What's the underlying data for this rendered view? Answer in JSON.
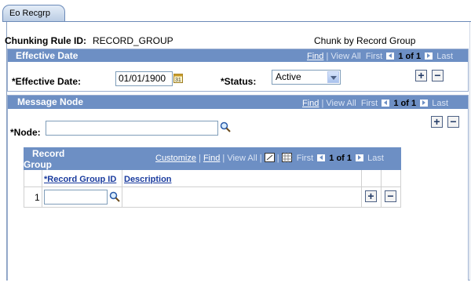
{
  "tab": {
    "label": "Eo Recgrp"
  },
  "header": {
    "chunking_rule_label": "Chunking Rule ID:",
    "chunking_rule_value": "RECORD_GROUP",
    "chunk_by": "Chunk by Record Group"
  },
  "effective_date_box": {
    "title": "Effective Date",
    "nav": {
      "find": "Find",
      "view_all": "View All",
      "first": "First",
      "count": "1 of 1",
      "last": "Last"
    },
    "effective_date_label": "*Effective Date:",
    "effective_date_value": "01/01/1900",
    "status_label": "*Status:",
    "status_value": "Active",
    "add_label": "+",
    "remove_label": "−"
  },
  "message_node_box": {
    "title": "Message Node",
    "nav": {
      "find": "Find",
      "view_all": "View All",
      "first": "First",
      "count": "1 of 1",
      "last": "Last"
    },
    "node_label": "*Node:",
    "node_value": "",
    "add_label": "+",
    "remove_label": "−"
  },
  "record_group_grid": {
    "title_line1": "Record",
    "title_line2": "Group",
    "nav": {
      "customize": "Customize",
      "find": "Find",
      "view_all": "View All",
      "first": "First",
      "count": "1 of 1",
      "last": "Last"
    },
    "columns": [
      "*Record Group ID",
      "Description"
    ],
    "rows": [
      {
        "num": "1",
        "record_group_id": "",
        "description": ""
      }
    ],
    "add_label": "+",
    "remove_label": "−"
  },
  "colors": {
    "header_blue": "#6d8fc4",
    "link_blue": "#1a3b9e"
  },
  "icons": [
    "calendar-icon",
    "lookup-icon",
    "grid-download-icon",
    "grid-zoom-icon"
  ]
}
